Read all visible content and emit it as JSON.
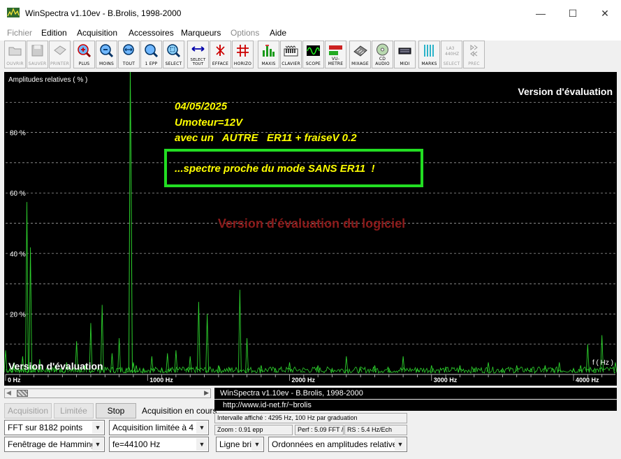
{
  "window": {
    "title": "WinSpectra v1.10ev - B.Brolis, 1998-2000",
    "minimize": "—",
    "maximize": "☐",
    "close": "✕"
  },
  "menu": [
    {
      "label": "Fichier",
      "disabled": true
    },
    {
      "label": "Edition",
      "disabled": false
    },
    {
      "label": "Acquisition",
      "disabled": false
    },
    {
      "label": "Accessoires",
      "disabled": false
    },
    {
      "label": "Marqueurs",
      "disabled": false
    },
    {
      "label": "Options",
      "disabled": true
    },
    {
      "label": "Aide",
      "disabled": false
    }
  ],
  "toolbar": [
    {
      "label": "OUVRIR",
      "icon": "folder-icon",
      "disabled": true
    },
    {
      "label": "SAUVER",
      "icon": "floppy-icon",
      "disabled": true
    },
    {
      "label": "PRINTER",
      "icon": "printer-icon",
      "disabled": true
    },
    {
      "label": "PLUS",
      "icon": "zoom-in-icon",
      "disabled": false
    },
    {
      "label": "MOINS",
      "icon": "zoom-out-icon",
      "disabled": false
    },
    {
      "label": "TOUT",
      "icon": "zoom-all-icon",
      "disabled": false
    },
    {
      "label": "1 EPP",
      "icon": "zoom-1-icon",
      "disabled": false
    },
    {
      "label": "SELECT",
      "icon": "zoom-select-icon",
      "disabled": false
    },
    {
      "label": "SELECT TOUT",
      "icon": "select-all-arrows-icon",
      "disabled": false
    },
    {
      "label": "EFFACE",
      "icon": "erase-icon",
      "disabled": false
    },
    {
      "label": "HORIZO",
      "icon": "horizontal-grid-icon",
      "disabled": false
    },
    {
      "label": "MAXIS",
      "icon": "bar-max-icon",
      "disabled": false
    },
    {
      "label": "CLAVIER",
      "icon": "keyboard-icon",
      "disabled": false
    },
    {
      "label": "SCOPE",
      "icon": "oscilloscope-icon",
      "disabled": false
    },
    {
      "label": "VU-METRE",
      "icon": "vu-meter-icon",
      "disabled": false
    },
    {
      "label": "MIXAGE",
      "icon": "mixer-icon",
      "disabled": false
    },
    {
      "label": "CD AUDIO",
      "icon": "cd-icon",
      "disabled": false
    },
    {
      "label": "MIDI",
      "icon": "midi-icon",
      "disabled": false
    },
    {
      "label": "MARKS",
      "icon": "marks-icon",
      "disabled": false
    },
    {
      "label": "SELECT",
      "icon": "select-disabled-icon",
      "disabled": true
    },
    {
      "label": "PREC",
      "icon": "prev-icon",
      "disabled": true
    }
  ],
  "plot": {
    "y_title": "Amplitudes relatives ( % )",
    "x_unit": "f ( Hz )",
    "watermark_top": "Version d'évaluation",
    "watermark_center": "Version d'évaluation du logiciel",
    "watermark_bottom": "Version d'évaluation",
    "y_ticks": [
      "80 %",
      "60 %",
      "40 %",
      "20 %"
    ],
    "x_ticks": [
      "0 Hz",
      "1000 Hz",
      "2000 Hz",
      "3000 Hz",
      "4000 Hz"
    ],
    "annotation_lines": [
      "04/05/2025",
      "Umoteur=12V",
      "avec un   AUTRE   ER11 + fraiseV 0.2"
    ],
    "boxed_note": "...spectre proche du mode SANS ER11  !",
    "colors": {
      "background": "#000000",
      "trace": "#2dd12d",
      "annotation": "#ffff00",
      "box": "#22dd22",
      "watermark": "#8b1a1a"
    }
  },
  "chart_data": {
    "type": "line",
    "title": "",
    "xlabel": "f ( Hz )",
    "ylabel": "Amplitudes relatives ( % )",
    "xlim": [
      0,
      4295
    ],
    "ylim": [
      0,
      100
    ],
    "grid": true,
    "series": [
      {
        "x": [
          0,
          30,
          60,
          90,
          120,
          150,
          175,
          200,
          240,
          300,
          350,
          390,
          430,
          470,
          500,
          530,
          560,
          600,
          680,
          750,
          800,
          850,
          900,
          920,
          970,
          1030,
          1100,
          1140,
          1160,
          1200,
          1280,
          1300,
          1360,
          1420,
          1500,
          1580,
          1650,
          1700,
          1800,
          1900,
          2000,
          2100,
          2200,
          2300,
          2400,
          2500,
          2600,
          2700,
          2800,
          2900,
          3000,
          3100,
          3200,
          3300,
          3400,
          3500,
          3600,
          3700,
          3800,
          3850,
          3900,
          4000,
          4050,
          4100,
          4150,
          4200,
          4295
        ],
        "y": [
          8,
          2,
          4,
          2,
          6,
          57,
          42,
          3,
          5,
          2,
          3,
          2,
          4,
          2,
          11,
          2,
          3,
          17,
          23,
          7,
          12,
          2,
          4,
          3,
          2,
          6,
          2,
          7,
          2,
          8,
          2,
          6,
          24,
          20,
          3,
          2,
          28,
          12,
          3,
          2,
          4,
          1,
          3,
          2,
          6,
          2,
          3,
          2,
          6,
          2,
          3,
          2,
          3,
          2,
          4,
          2,
          3,
          2,
          3,
          2,
          4,
          2,
          3,
          10,
          2,
          13,
          4
        ]
      }
    ],
    "annotations": [
      "04/05/2025",
      "Umoteur=12V",
      "avec un   AUTRE   ER11 + fraiseV 0.2",
      "...spectre proche du mode SANS ER11  !"
    ]
  },
  "controls": {
    "acquisition_btn": "Acquisition",
    "limitee_btn": "Limitée",
    "stop_btn": "Stop",
    "status": "Acquisition en cours",
    "fft_select": "FFT sur 8182 points",
    "limit_select": "Acquisition limitée à 4 s",
    "window_select": "Fenêtrage de Hamming",
    "fe_select": "fe=44100 Hz",
    "line_select": "Ligne bris",
    "ordinate_select": "Ordonnées en amplitudes relatives"
  },
  "info": {
    "credit": "WinSpectra v1.10ev - B.Brolis, 1998-2000",
    "url": "http://www.id-net.fr/~brolis",
    "interval": "Intervalle affiché : 4295 Hz, 100 Hz par graduation",
    "zoom": "Zoom : 0.91 epp",
    "perf": "Perf : 5.09 FFT / s",
    "rs": "RS :   5.4 Hz/Ech"
  }
}
